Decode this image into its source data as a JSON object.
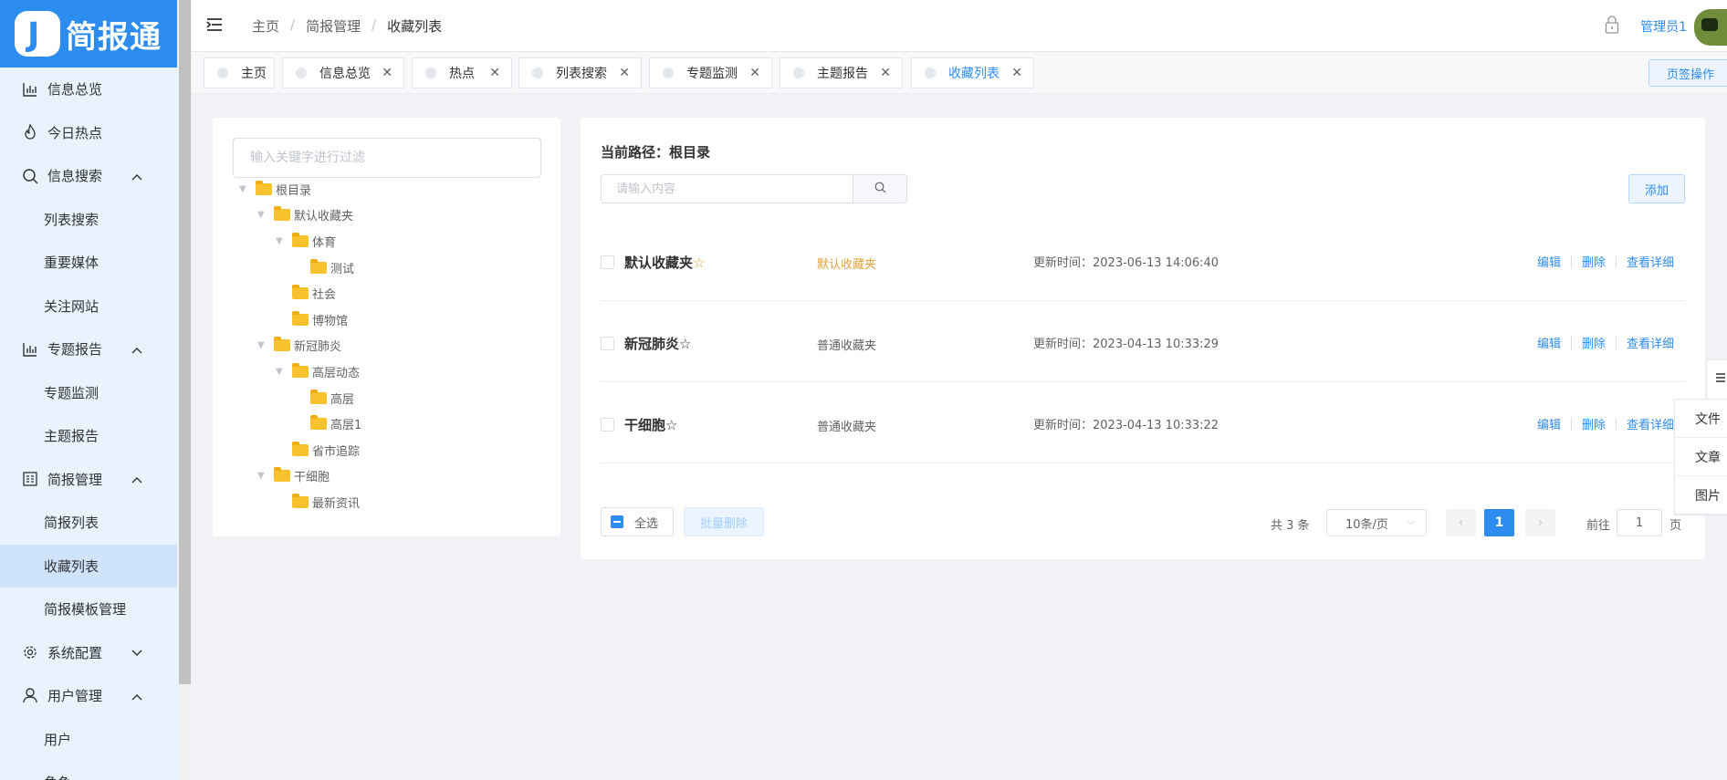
{
  "app": {
    "logo_mark": "J",
    "logo_text": "简报通"
  },
  "sidebar": {
    "items": [
      {
        "label": "信息总览",
        "icon": "bar-chart-icon"
      },
      {
        "label": "今日热点",
        "icon": "fire-icon"
      },
      {
        "label": "信息搜索",
        "icon": "search-icon",
        "expanded": true
      },
      {
        "label": "列表搜索"
      },
      {
        "label": "重要媒体"
      },
      {
        "label": "关注网站"
      },
      {
        "label": "专题报告",
        "icon": "bar-chart-icon",
        "expanded": true
      },
      {
        "label": "专题监测"
      },
      {
        "label": "主题报告"
      },
      {
        "label": "简报管理",
        "icon": "document-icon",
        "expanded": true
      },
      {
        "label": "简报列表"
      },
      {
        "label": "收藏列表",
        "active": true
      },
      {
        "label": "简报模板管理"
      },
      {
        "label": "系统配置",
        "icon": "gear-icon",
        "expanded": false
      },
      {
        "label": "用户管理",
        "icon": "user-icon",
        "expanded": true
      },
      {
        "label": "用户"
      },
      {
        "label": "角色"
      }
    ]
  },
  "header": {
    "breadcrumb": [
      "主页",
      "简报管理",
      "收藏列表"
    ],
    "user": "管理员1"
  },
  "tabs": [
    {
      "label": "主页"
    },
    {
      "label": "信息总览"
    },
    {
      "label": "热点"
    },
    {
      "label": "列表搜索"
    },
    {
      "label": "专题监测"
    },
    {
      "label": "主题报告"
    },
    {
      "label": "收藏列表",
      "active": true
    }
  ],
  "tab_ops_label": "页签操作",
  "tree": {
    "filter_placeholder": "输入关键字进行过滤",
    "nodes": [
      {
        "label": "根目录"
      },
      {
        "label": "默认收藏夹"
      },
      {
        "label": "体育"
      },
      {
        "label": "测试"
      },
      {
        "label": "社会"
      },
      {
        "label": "博物馆"
      },
      {
        "label": "新冠肺炎"
      },
      {
        "label": "高层动态"
      },
      {
        "label": "高层"
      },
      {
        "label": "高层1"
      },
      {
        "label": "省市追踪"
      },
      {
        "label": "干细胞"
      },
      {
        "label": "最新资讯"
      }
    ]
  },
  "list": {
    "path": "当前路径：根目录",
    "search_placeholder": "请输入内容",
    "add_label": "添加",
    "rows": [
      {
        "name": "默认收藏夹",
        "star": "☆",
        "type": "默认收藏夹",
        "time": "更新时间：2023-06-13 14:06:40"
      },
      {
        "name": "新冠肺炎",
        "star": "☆",
        "type": "普通收藏夹",
        "time": "更新时间：2023-04-13 10:33:29"
      },
      {
        "name": "干细胞",
        "star": "☆",
        "type": "普通收藏夹",
        "time": "更新时间：2023-04-13 10:33:22"
      }
    ],
    "actions": {
      "edit": "编辑",
      "delete": "删除",
      "detail": "查看详细"
    },
    "select_all": "全选",
    "batch_delete": "批量删除",
    "total": "共 3 条",
    "page_size": "10条/页",
    "current_page": "1",
    "goto_label": "前往",
    "goto_value": "1",
    "goto_suffix": "页"
  },
  "float_menu": {
    "items": [
      "文件",
      "文章",
      "图片"
    ]
  },
  "colors": {
    "brand": "#2d8cf0",
    "sidebar_bg": "#e8f3fe",
    "sidebar_active": "#cfe3fc",
    "warning": "#e6a23c"
  }
}
